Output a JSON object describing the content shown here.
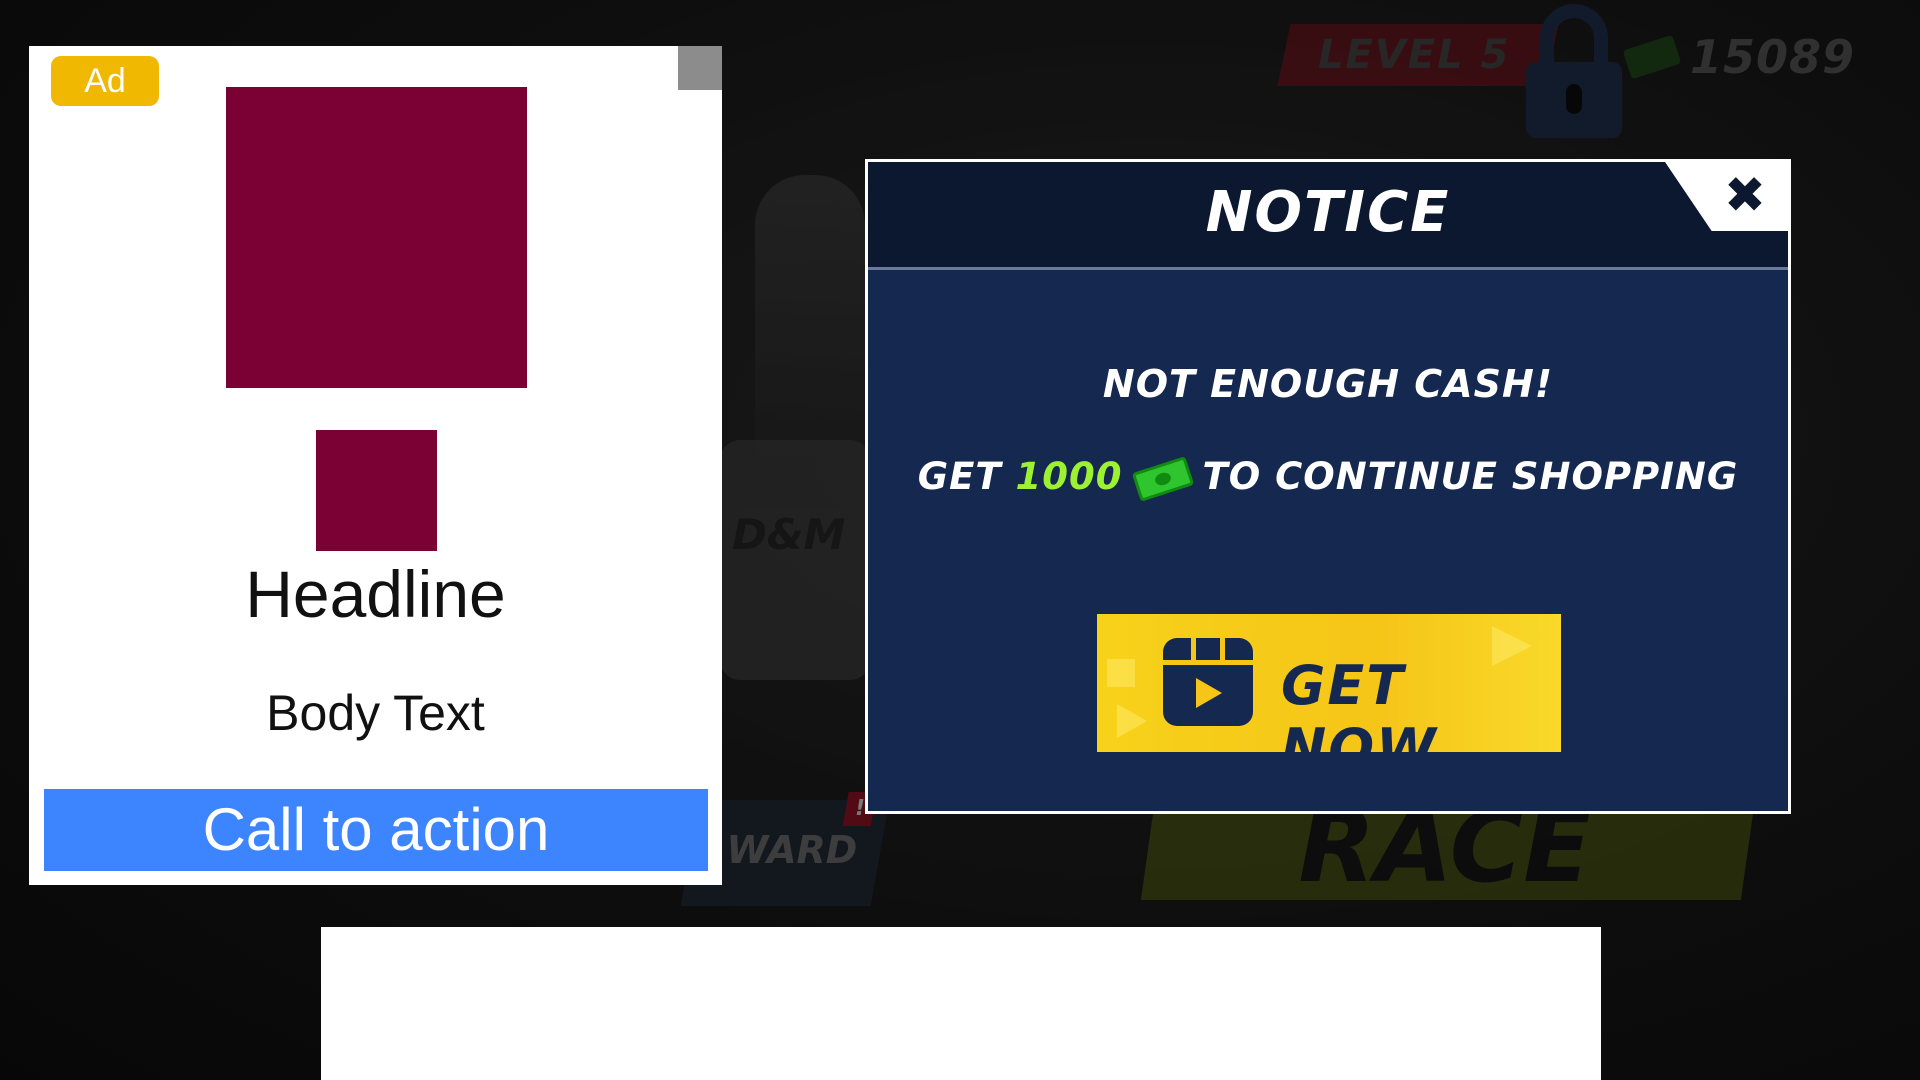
{
  "game": {
    "level_label": "LEVEL 5",
    "cash_amount": "15089",
    "race_label": "RACE",
    "reward_label": "WARD",
    "bike_text": "D&M"
  },
  "ad": {
    "badge": "Ad",
    "headline": "Headline",
    "body": "Body Text",
    "cta": "Call to action",
    "image_color": "#7b0033",
    "cta_color": "#3d85ff",
    "badge_color": "#f0b800"
  },
  "notice": {
    "title": "NOTICE",
    "close_icon": "close-icon",
    "message_line1": "NOT ENOUGH CASH!",
    "message_prefix": "GET",
    "message_amount": "1000",
    "message_suffix": "TO CONTINUE SHOPPING",
    "currency_icon": "cash-icon",
    "button_label": "GET NOW",
    "button_icon": "video-reward-icon",
    "colors": {
      "panel": "#15284f",
      "header": "#0b1830",
      "amount": "#9cf232",
      "button": "#f5c518"
    }
  }
}
